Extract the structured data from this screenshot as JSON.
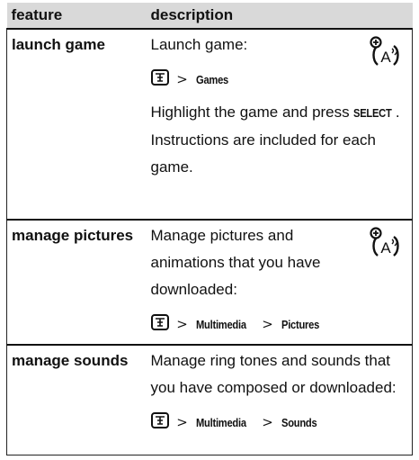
{
  "table": {
    "headers": {
      "feature": "feature",
      "description": "description"
    },
    "rows": [
      {
        "feature": "launch game",
        "intro": "Launch game:",
        "menu_path": [
          "Games"
        ],
        "paragraph_before": "Highlight the game and press ",
        "paragraph_key": "SELECT",
        "paragraph_after": ". Instructions are included for each game.",
        "badge_icon": "network-feature-icon"
      },
      {
        "feature": "manage pictures",
        "intro": "Manage pictures and animations that you have downloaded:",
        "menu_path": [
          "Multimedia",
          "Pictures"
        ],
        "badge_icon": "network-feature-icon"
      },
      {
        "feature": "manage sounds",
        "intro": "Manage ring tones and sounds that you have composed or downloaded:",
        "menu_path": [
          "Multimedia",
          "Sounds"
        ]
      }
    ],
    "separator": ">",
    "menu_key_icon": "menu-key-icon"
  }
}
